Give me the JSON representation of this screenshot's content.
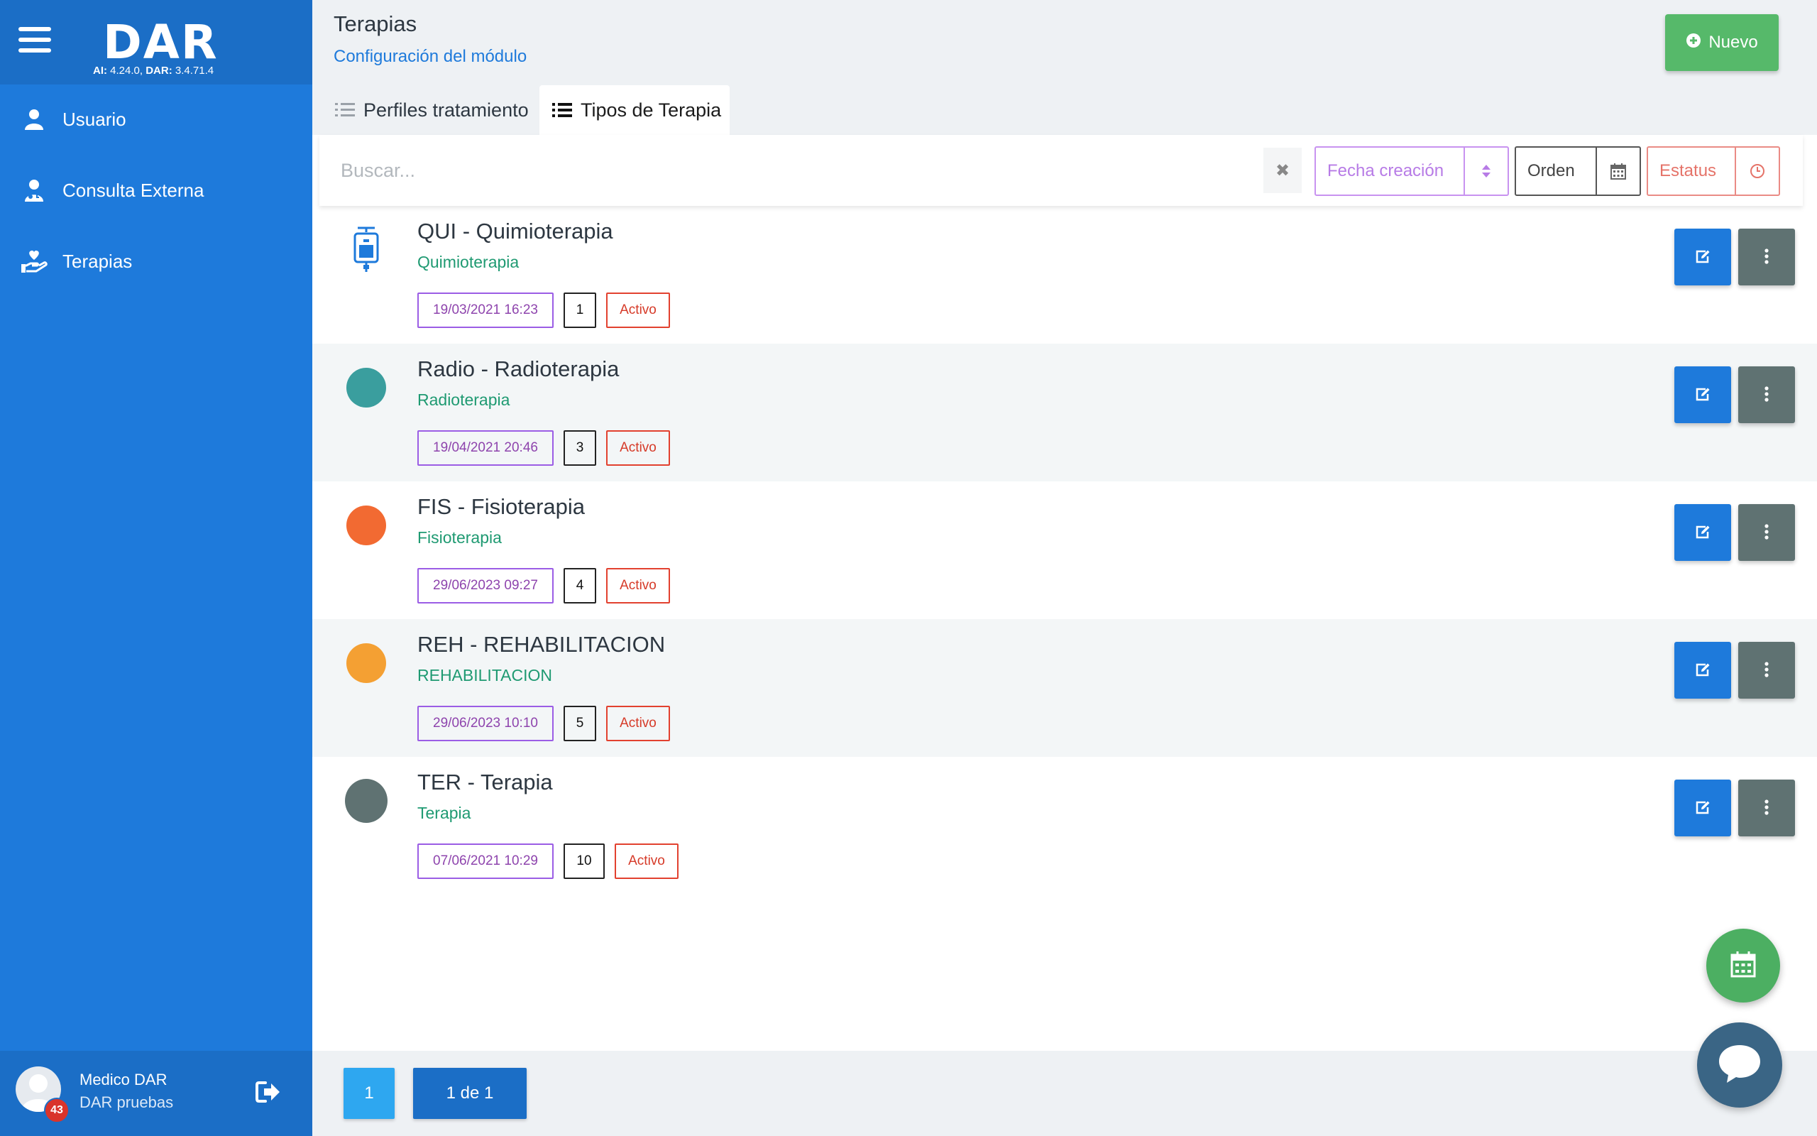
{
  "app": {
    "logo": "DAR",
    "version_ai_label": "AI:",
    "version_ai_value": "4.24.0,",
    "version_dar_label": "DAR:",
    "version_dar_value": "3.4.71.4"
  },
  "sidebar": {
    "items": [
      {
        "label": "Usuario",
        "icon": "user-icon"
      },
      {
        "label": "Consulta Externa",
        "icon": "doctor-icon"
      },
      {
        "label": "Terapias",
        "icon": "hand-heart-icon"
      }
    ],
    "user": {
      "name": "Medico DAR",
      "org": "DAR pruebas",
      "notifications": "43"
    }
  },
  "header": {
    "title": "Terapias",
    "subtitle": "Configuración del módulo",
    "new_label": "Nuevo"
  },
  "tabs": [
    {
      "label": "Perfiles tratamiento",
      "active": false
    },
    {
      "label": "Tipos de Terapia",
      "active": true
    }
  ],
  "search": {
    "placeholder": "Buscar..."
  },
  "filters": {
    "fecha": "Fecha creación",
    "orden": "Orden",
    "estatus": "Estatus"
  },
  "rows": [
    {
      "title": "QUI - Quimioterapia",
      "subtitle": "Quimioterapia",
      "date": "19/03/2021 16:23",
      "order": "1",
      "status": "Activo",
      "icon": "iv-bag-icon",
      "color": "#1e7adb"
    },
    {
      "title": "Radio - Radioterapia",
      "subtitle": "Radioterapia",
      "date": "19/04/2021 20:46",
      "order": "3",
      "status": "Activo",
      "icon": "color-dot",
      "color": "#3a9e9e"
    },
    {
      "title": "FIS - Fisioterapia",
      "subtitle": "Fisioterapia",
      "date": "29/06/2023 09:27",
      "order": "4",
      "status": "Activo",
      "icon": "color-dot",
      "color": "#f26a32"
    },
    {
      "title": "REH - REHABILITACION",
      "subtitle": "REHABILITACION",
      "date": "29/06/2023 10:10",
      "order": "5",
      "status": "Activo",
      "icon": "color-dot",
      "color": "#f4a033"
    },
    {
      "title": "TER - Terapia",
      "subtitle": "Terapia",
      "date": "07/06/2021 10:29",
      "order": "10",
      "status": "Activo",
      "icon": "color-dot",
      "color": "#5f7272"
    }
  ],
  "pagination": {
    "current": "1",
    "total": "1 de 1"
  }
}
